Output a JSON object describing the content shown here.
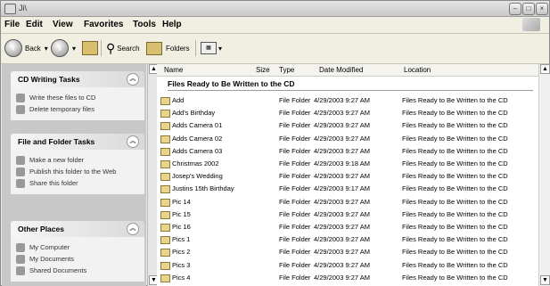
{
  "window": {
    "title": "Ji\\"
  },
  "menu": {
    "file": "File",
    "edit": "Edit",
    "view": "View",
    "favorites": "Favorites",
    "tools": "Tools",
    "help": "Help"
  },
  "toolbar": {
    "back": "Back",
    "search": "Search",
    "folders": "Folders"
  },
  "cd_tasks": {
    "title": "CD Writing Tasks",
    "items": [
      "Write these files to CD",
      "Delete temporary files"
    ]
  },
  "file_tasks": {
    "title": "File and Folder Tasks",
    "items": [
      "Make a new folder",
      "Publish this folder to the Web",
      "Share this folder"
    ]
  },
  "other_places": {
    "title": "Other Places",
    "items": [
      "My Computer",
      "My Documents",
      "Shared Documents"
    ]
  },
  "columns": {
    "name": "Name",
    "size": "Size",
    "type": "Type",
    "date": "Date Modified",
    "location": "Location"
  },
  "group_title": "Files Ready to Be Written to the CD",
  "files": [
    {
      "name": "Add",
      "type": "File Folder",
      "date": "4/29/2003 9:27 AM",
      "location": "Files Ready to Be Written to the CD"
    },
    {
      "name": "Add's Birthday",
      "type": "File Folder",
      "date": "4/29/2003 9:27 AM",
      "location": "Files Ready to Be Written to the CD"
    },
    {
      "name": "Adds Camera 01",
      "type": "File Folder",
      "date": "4/29/2003 9:27 AM",
      "location": "Files Ready to Be Written to the CD"
    },
    {
      "name": "Adds Camera 02",
      "type": "File Folder",
      "date": "4/29/2003 9:27 AM",
      "location": "Files Ready to Be Written to the CD"
    },
    {
      "name": "Adds Camera 03",
      "type": "File Folder",
      "date": "4/29/2003 9:27 AM",
      "location": "Files Ready to Be Written to the CD"
    },
    {
      "name": "Christmas 2002",
      "type": "File Folder",
      "date": "4/29/2003 9:18 AM",
      "location": "Files Ready to Be Written to the CD"
    },
    {
      "name": "Josep's Wedding",
      "type": "File Folder",
      "date": "4/29/2003 9:27 AM",
      "location": "Files Ready to Be Written to the CD"
    },
    {
      "name": "Justins 15th Birthday",
      "type": "File Folder",
      "date": "4/29/2003 9:17 AM",
      "location": "Files Ready to Be Written to the CD"
    },
    {
      "name": "Pic 14",
      "type": "File Folder",
      "date": "4/29/2003 9:27 AM",
      "location": "Files Ready to Be Written to the CD"
    },
    {
      "name": "Pic 15",
      "type": "File Folder",
      "date": "4/29/2003 9:27 AM",
      "location": "Files Ready to Be Written to the CD"
    },
    {
      "name": "Pic 16",
      "type": "File Folder",
      "date": "4/29/2003 9:27 AM",
      "location": "Files Ready to Be Written to the CD"
    },
    {
      "name": "Pics 1",
      "type": "File Folder",
      "date": "4/29/2003 9:27 AM",
      "location": "Files Ready to Be Written to the CD"
    },
    {
      "name": "Pics 2",
      "type": "File Folder",
      "date": "4/29/2003 9:27 AM",
      "location": "Files Ready to Be Written to the CD"
    },
    {
      "name": "Pics 3",
      "type": "File Folder",
      "date": "4/29/2003 9:27 AM",
      "location": "Files Ready to Be Written to the CD"
    },
    {
      "name": "Pics 4",
      "type": "File Folder",
      "date": "4/29/2003 9:27 AM",
      "location": "Files Ready to Be Written to the CD"
    }
  ]
}
